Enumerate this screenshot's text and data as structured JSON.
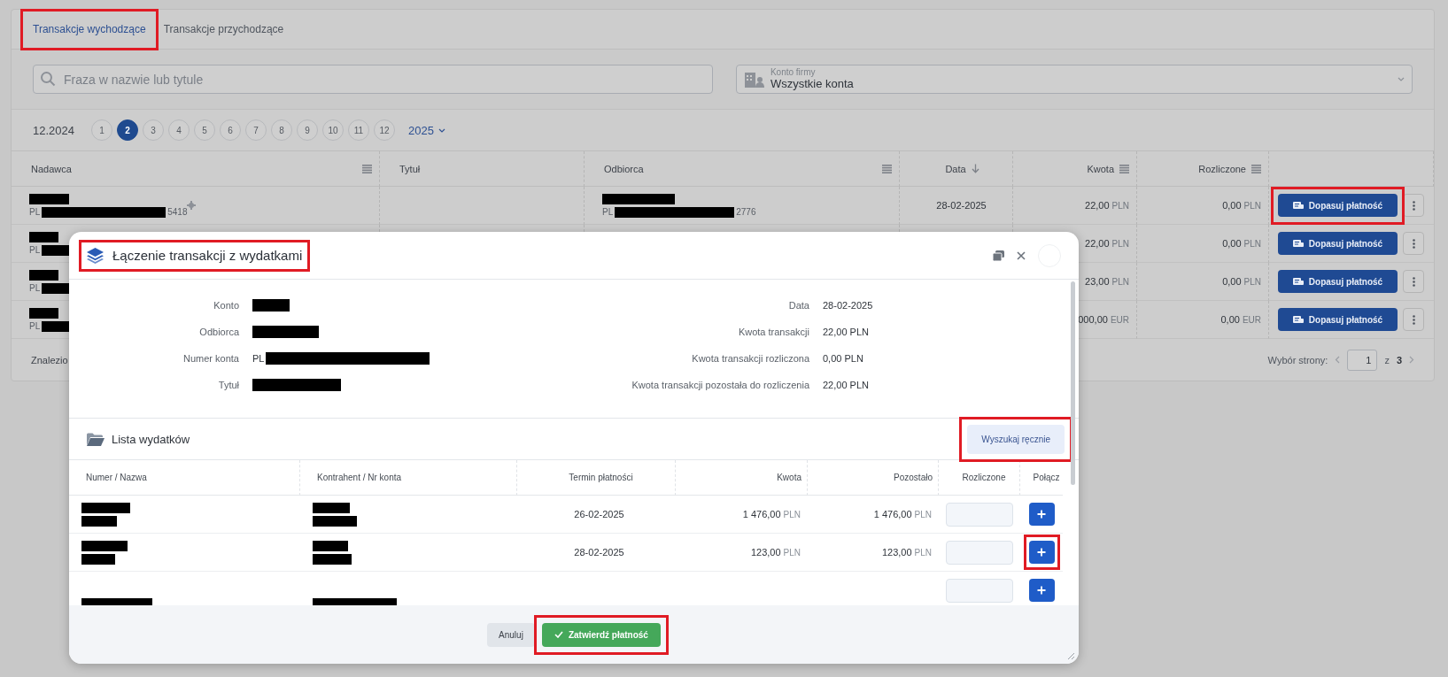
{
  "tabs": [
    {
      "label": "Transakcje wychodzące",
      "selected": true,
      "highlighted": true
    },
    {
      "label": "Transakcje przychodzące",
      "selected": false,
      "highlighted": false
    }
  ],
  "search": {
    "placeholder": "Fraza w nazwie lub tytule"
  },
  "account_select": {
    "label": "Konto firmy",
    "value": "Wszystkie konta"
  },
  "period": {
    "previous": "12.2024",
    "months": [
      {
        "label": "1",
        "selected": false
      },
      {
        "label": "2",
        "selected": true
      },
      {
        "label": "3",
        "selected": false
      },
      {
        "label": "4",
        "selected": false
      },
      {
        "label": "5",
        "selected": false
      },
      {
        "label": "6",
        "selected": false
      },
      {
        "label": "7",
        "selected": false
      },
      {
        "label": "8",
        "selected": false
      },
      {
        "label": "9",
        "selected": false
      },
      {
        "label": "10",
        "selected": false
      },
      {
        "label": "11",
        "selected": false
      },
      {
        "label": "12",
        "selected": false
      }
    ],
    "year": "2025"
  },
  "table": {
    "columns": [
      {
        "label": "Nadawca",
        "kind": "menu"
      },
      {
        "label": "Tytuł",
        "kind": "plain"
      },
      {
        "label": "Odbiorca",
        "kind": "menu"
      },
      {
        "label": "Data",
        "kind": "sorted"
      },
      {
        "label": "Kwota",
        "kind": "menu"
      },
      {
        "label": "Rozliczone",
        "kind": "menu"
      }
    ],
    "rows": [
      {
        "sender_prefix": "PL",
        "sender_suffix": "5418",
        "recipient_prefix": "PL",
        "recipient_suffix": "2776",
        "date": "28-02-2025",
        "amount": "22,00",
        "currency": "PLN",
        "settled": "0,00",
        "settled_currency": "PLN",
        "action": "Dopasuj płatność",
        "highlighted": true
      },
      {
        "sender_prefix": "PL",
        "amount": "22,00",
        "currency": "PLN",
        "settled": "0,00",
        "settled_currency": "PLN",
        "action": "Dopasuj płatność",
        "highlighted": false
      },
      {
        "sender_prefix": "PL",
        "amount": "23,00",
        "currency": "PLN",
        "settled": "0,00",
        "settled_currency": "PLN",
        "action": "Dopasuj płatność",
        "highlighted": false
      },
      {
        "sender_prefix": "PL",
        "amount": "000,00",
        "currency": "EUR",
        "settled": "0,00",
        "settled_currency": "EUR",
        "action": "Dopasuj płatność",
        "highlighted": false
      }
    ],
    "footer": {
      "found": "Znalezio",
      "page_label": "Wybór strony:",
      "page": "1",
      "of": "z",
      "pages": "3"
    }
  },
  "modal": {
    "title": "Łączenie transakcji z wydatkami",
    "title_highlighted": true,
    "details_left": [
      {
        "label": "Konto"
      },
      {
        "label": "Odbiorca"
      },
      {
        "label": "Numer konta",
        "prefix": "PL"
      },
      {
        "label": "Tytuł"
      }
    ],
    "details_right": [
      {
        "label": "Data",
        "value": "28-02-2025"
      },
      {
        "label": "Kwota transakcji",
        "value": "22,00 PLN"
      },
      {
        "label": "Kwota transakcji rozliczona",
        "value": "0,00 PLN"
      },
      {
        "label": "Kwota transakcji pozostała do rozliczenia",
        "value": "22,00 PLN"
      }
    ],
    "list_title": "Lista wydatków",
    "search_button": {
      "label": "Wyszukaj ręcznie",
      "highlighted": true
    },
    "columns": [
      "Numer / Nazwa",
      "Kontrahent / Nr konta",
      "Termin płatności",
      "Kwota",
      "Pozostało",
      "Rozliczone",
      "Połącz"
    ],
    "rows": [
      {
        "kind": "full",
        "due": "26-02-2025",
        "amount": "1 476,00",
        "currency": "PLN",
        "remaining": "1 476,00",
        "remaining_currency": "PLN",
        "highlighted": false
      },
      {
        "kind": "full",
        "due": "28-02-2025",
        "amount": "123,00",
        "currency": "PLN",
        "remaining": "123,00",
        "remaining_currency": "PLN",
        "highlighted": true
      },
      {
        "kind": "partial",
        "highlighted": false
      }
    ],
    "buttons": [
      {
        "label": "Anuluj",
        "kind": "cancel",
        "highlighted": false
      },
      {
        "label": "Zatwierdź płatność",
        "kind": "confirm",
        "highlighted": true
      }
    ]
  }
}
